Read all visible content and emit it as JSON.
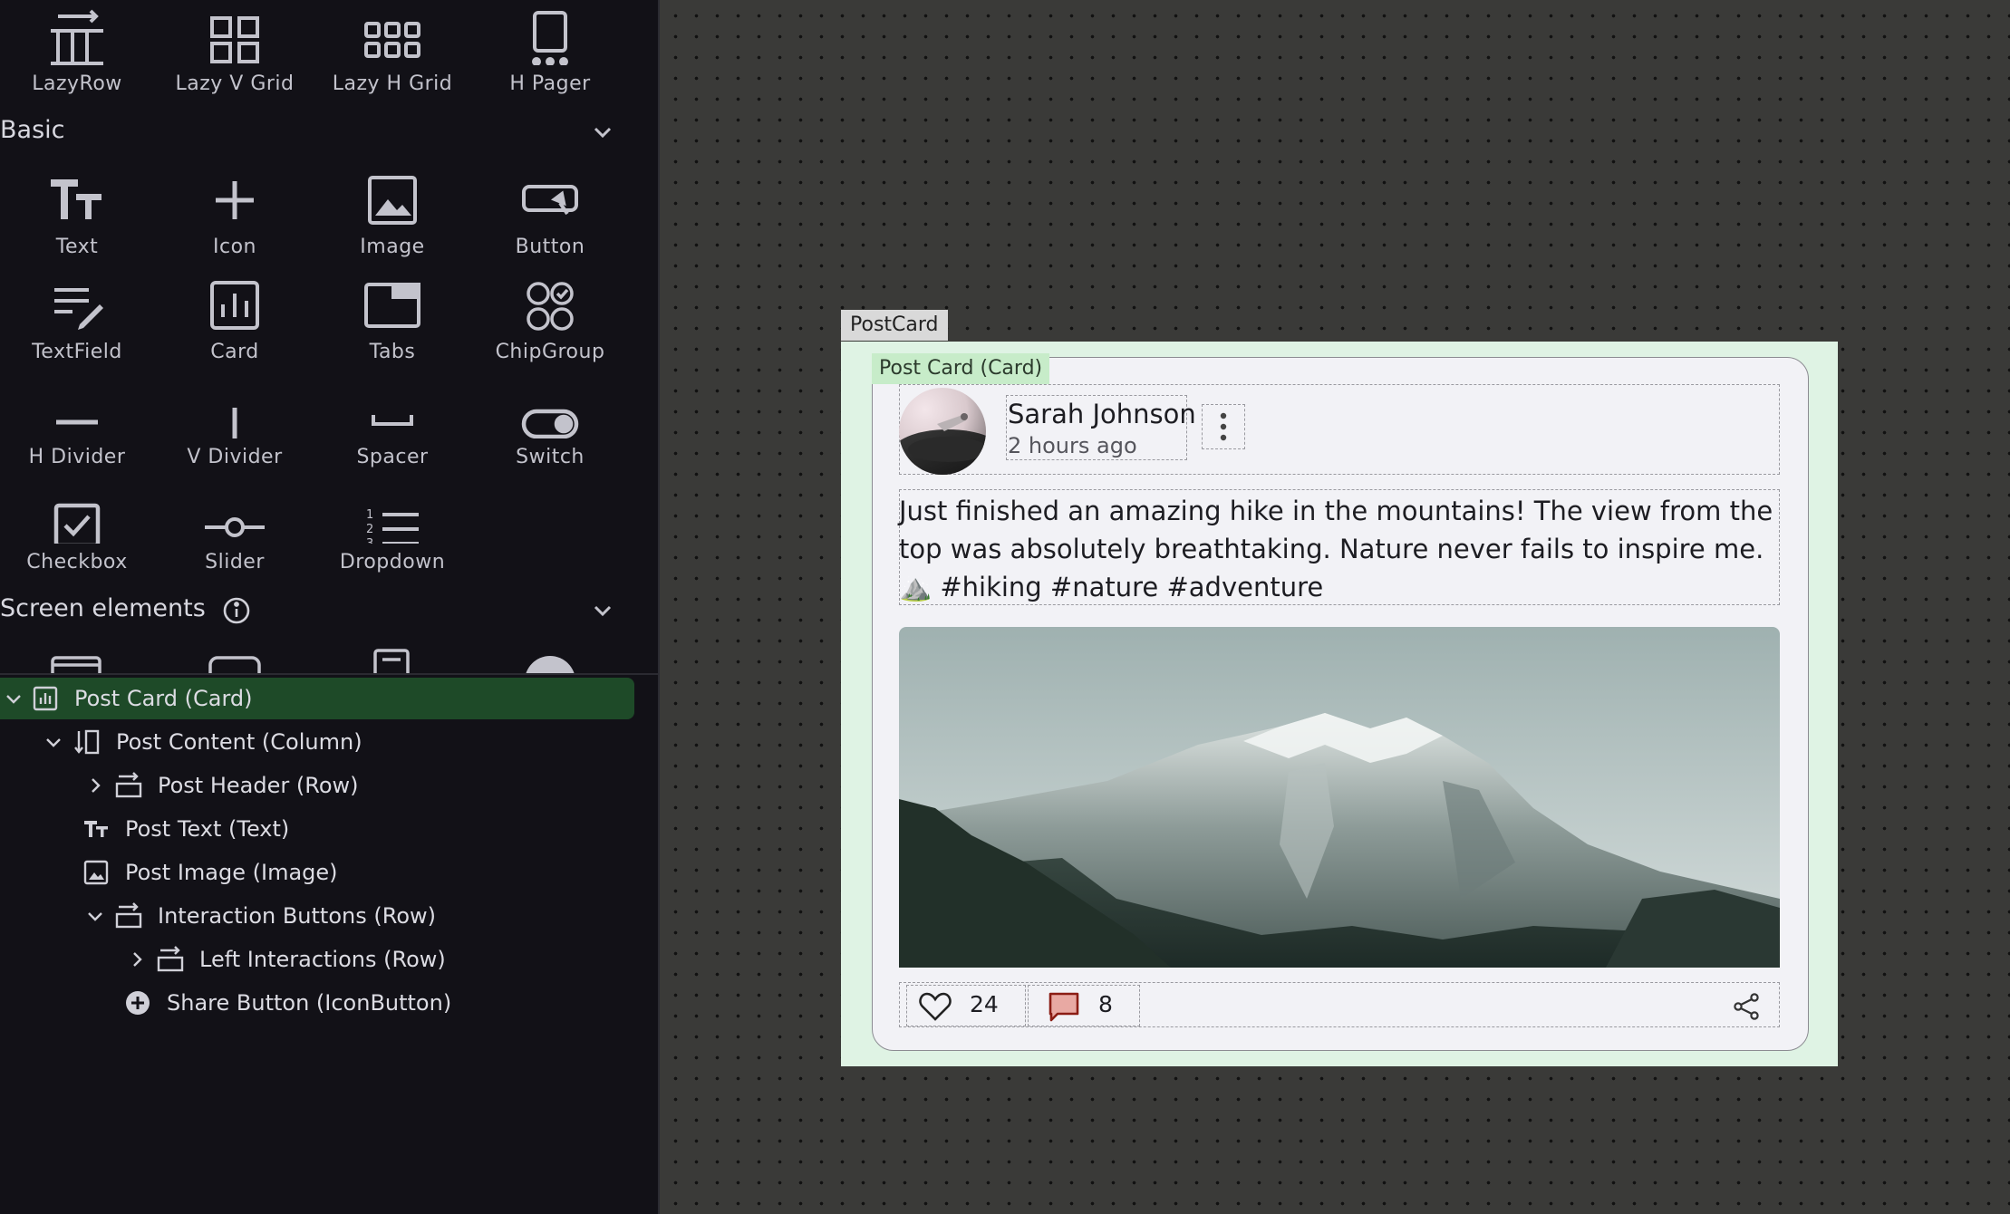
{
  "palette": {
    "layout_items": [
      {
        "label": "LazyRow",
        "icon": "lazy-row-icon"
      },
      {
        "label": "Lazy V Grid",
        "icon": "lazy-v-grid-icon"
      },
      {
        "label": "Lazy H Grid",
        "icon": "lazy-h-grid-icon"
      },
      {
        "label": "H Pager",
        "icon": "h-pager-icon"
      }
    ],
    "basic_title": "Basic",
    "basic_items": [
      {
        "label": "Text",
        "icon": "text-icon"
      },
      {
        "label": "Icon",
        "icon": "plus-icon"
      },
      {
        "label": "Image",
        "icon": "image-icon"
      },
      {
        "label": "Button",
        "icon": "button-icon"
      },
      {
        "label": "TextField",
        "icon": "text-field-icon"
      },
      {
        "label": "Card",
        "icon": "card-icon"
      },
      {
        "label": "Tabs",
        "icon": "tabs-icon"
      },
      {
        "label": "ChipGroup",
        "icon": "chip-group-icon"
      },
      {
        "label": "H Divider",
        "icon": "h-divider-icon"
      },
      {
        "label": "V Divider",
        "icon": "v-divider-icon"
      },
      {
        "label": "Spacer",
        "icon": "spacer-icon"
      },
      {
        "label": "Switch",
        "icon": "switch-icon"
      },
      {
        "label": "Checkbox",
        "icon": "checkbox-icon"
      },
      {
        "label": "Slider",
        "icon": "slider-icon"
      },
      {
        "label": "Dropdown",
        "icon": "dropdown-icon"
      }
    ],
    "screen_elements_title": "Screen elements"
  },
  "tree": [
    {
      "label": "Post Card (Card)",
      "icon": "card-icon",
      "expanded": true,
      "selected": true
    },
    {
      "label": "Post Content (Column)",
      "icon": "column-icon",
      "expanded": true
    },
    {
      "label": "Post Header (Row)",
      "icon": "row-icon",
      "expanded": false
    },
    {
      "label": "Post Text (Text)",
      "icon": "text-icon"
    },
    {
      "label": "Post Image (Image)",
      "icon": "image-icon"
    },
    {
      "label": "Interaction Buttons (Row)",
      "icon": "row-icon",
      "expanded": true
    },
    {
      "label": "Left Interactions (Row)",
      "icon": "row-icon",
      "expanded": false
    },
    {
      "label": "Share Button (IconButton)",
      "icon": "add-circle-icon"
    }
  ],
  "canvas": {
    "frame_label": "PostCard",
    "card_label": "Post Card (Card)",
    "author_name": "Sarah Johnson",
    "post_time": "2 hours ago",
    "post_text": "Just finished an amazing hike in the mountains! The view from the top was absolutely breathtaking. Nature never fails to inspire me. ⛰️ #hiking #nature #adventure",
    "like_count": "24",
    "comment_count": "8"
  },
  "colors": {
    "panel_bg": "#121117",
    "selected_row": "#1e4a28",
    "canvas_bg": "#3a3a38",
    "frame_bg": "#dff3e4",
    "card_bg": "#f2f2f6",
    "card_tag_bg": "#c7ecc9",
    "comment_icon": "#c0392b"
  }
}
